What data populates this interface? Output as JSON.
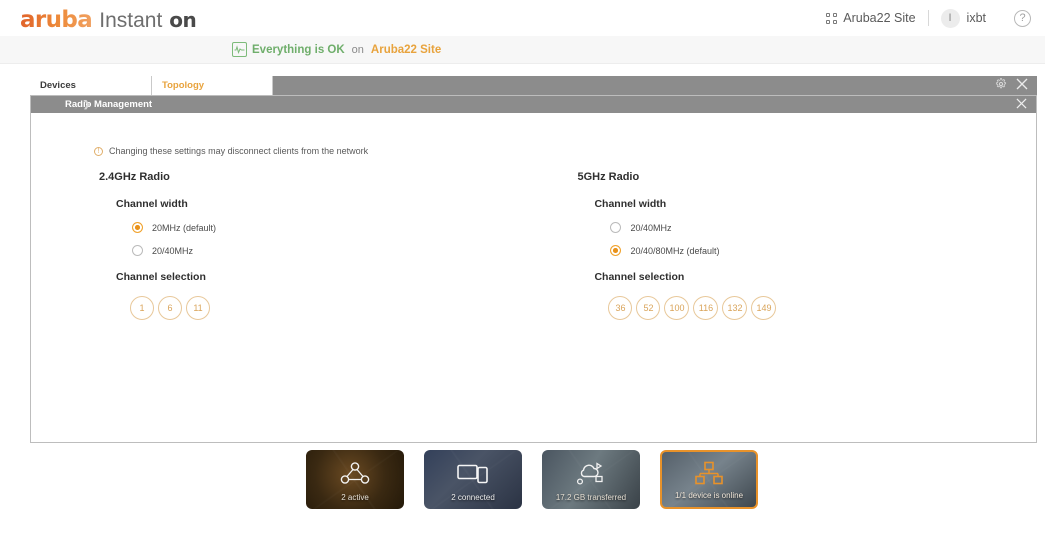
{
  "header": {
    "logo": {
      "brand": "aruba",
      "product": "Instant",
      "suffix": "on"
    },
    "site_label": "Aruba22 Site",
    "user_initial": "I",
    "user_name": "ixbt",
    "grid_icon": "grid-icon",
    "help_icon": "question-mark-icon"
  },
  "status": {
    "icon": "pulse-monitor-icon",
    "message": "Everything is OK",
    "preposition": "on",
    "site": "Aruba22 Site"
  },
  "tabs": [
    {
      "label": "Devices",
      "active": false
    },
    {
      "label": "Topology",
      "active": true
    }
  ],
  "tabbar_icons": {
    "gear": "gear-icon",
    "close": "close-icon"
  },
  "panel": {
    "title": "Radio Management",
    "chevron": "chevron-right-icon",
    "close": "close-icon",
    "warning": {
      "icon": "warning-icon",
      "text": "Changing these settings may disconnect clients from the network"
    },
    "radios": [
      {
        "title": "2.4GHz Radio",
        "channel_width_label": "Channel width",
        "width_options": [
          {
            "label": "20MHz (default)",
            "selected": true
          },
          {
            "label": "20/40MHz",
            "selected": false
          }
        ],
        "channel_selection_label": "Channel selection",
        "channels": [
          "1",
          "6",
          "11"
        ]
      },
      {
        "title": "5GHz Radio",
        "channel_width_label": "Channel width",
        "width_options": [
          {
            "label": "20/40MHz",
            "selected": false
          },
          {
            "label": "20/40/80MHz (default)",
            "selected": true
          }
        ],
        "channel_selection_label": "Channel selection",
        "channels": [
          "36",
          "52",
          "100",
          "116",
          "132",
          "149"
        ]
      }
    ]
  },
  "tiles": [
    {
      "label": "2 active",
      "icon": "network-share-icon",
      "selected": false
    },
    {
      "label": "2 connected",
      "icon": "devices-icon",
      "selected": false
    },
    {
      "label": "17.2 GB transferred",
      "icon": "cloud-apps-icon",
      "selected": false
    },
    {
      "label": "1/1 device is online",
      "icon": "device-tree-icon",
      "selected": true
    }
  ],
  "colors": {
    "accent_orange": "#E8922A",
    "status_green": "#6FAE6B",
    "panel_gray": "#8C8C8C",
    "chip_border": "#E8C89A"
  }
}
